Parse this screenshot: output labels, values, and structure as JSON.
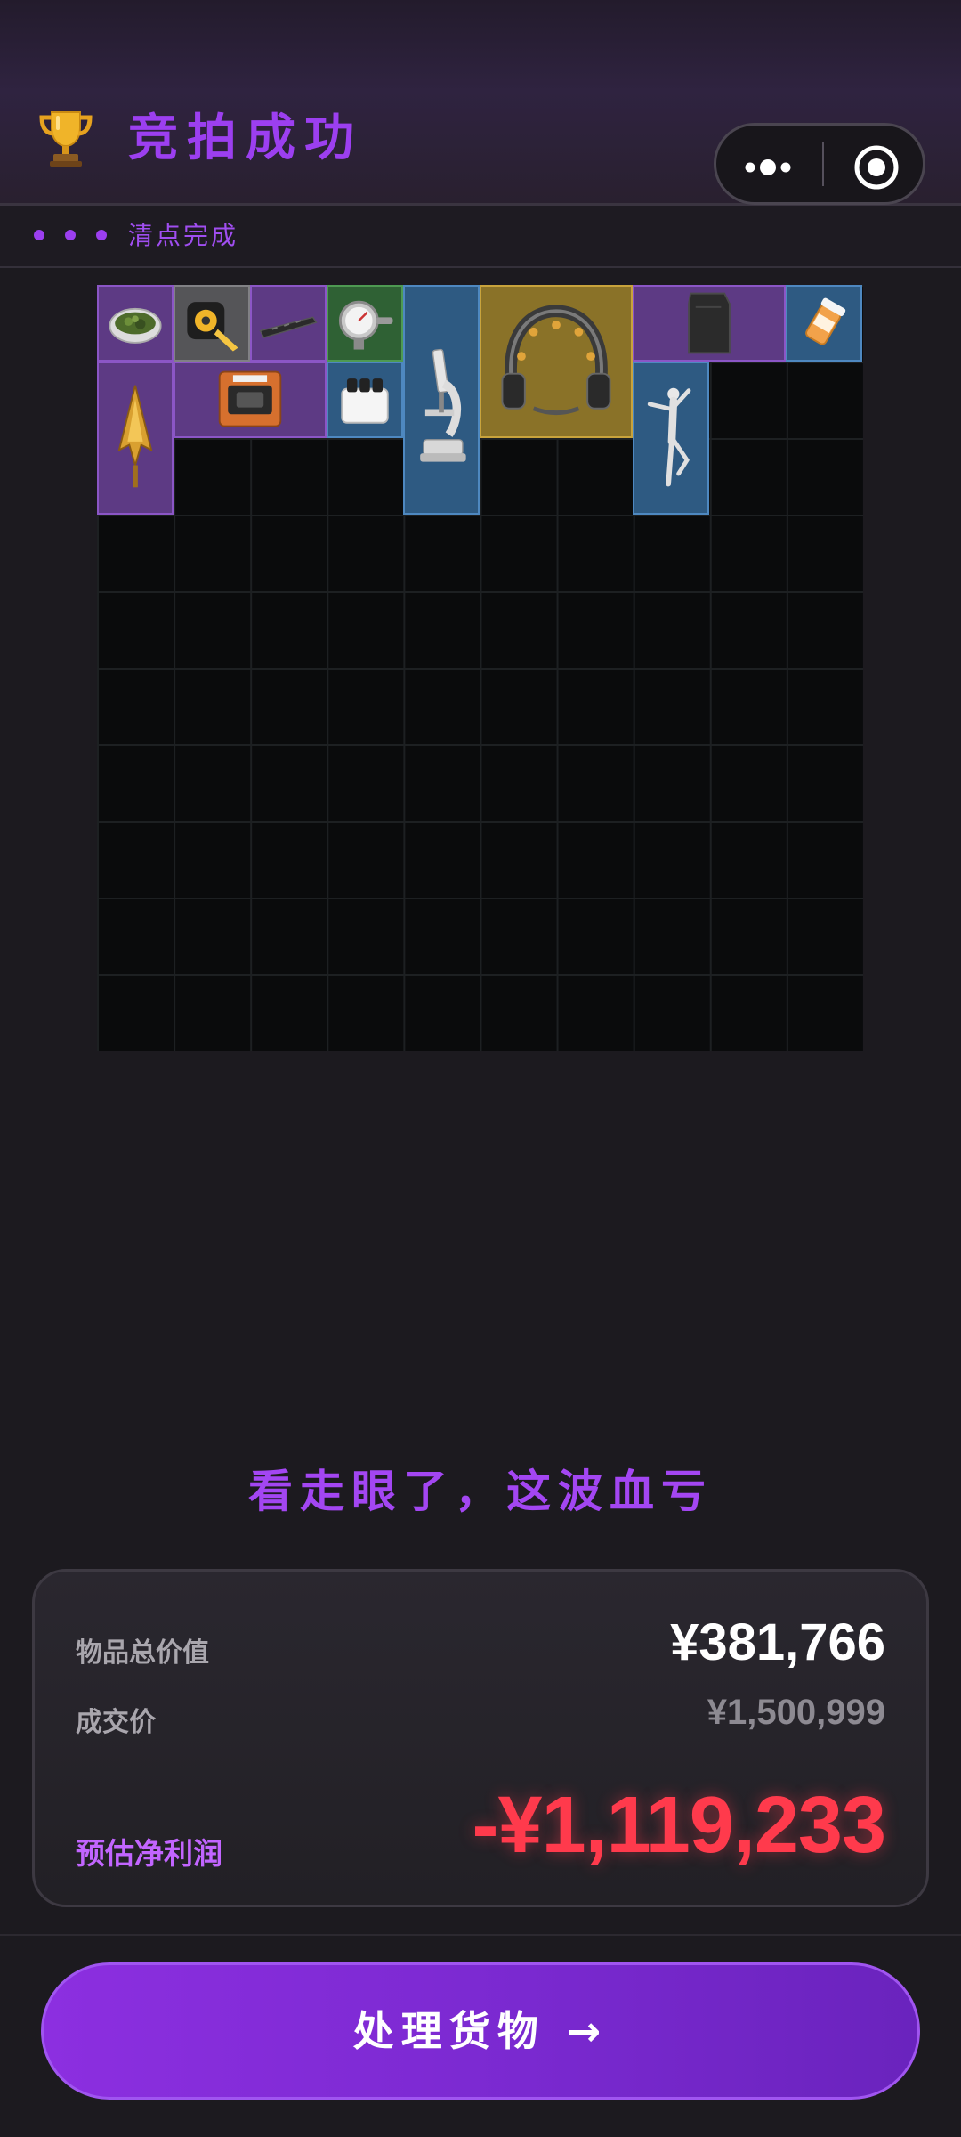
{
  "header": {
    "title": "竞拍成功",
    "trophy_icon": "trophy-icon"
  },
  "status": {
    "text": "清点完成"
  },
  "colors": {
    "accent": "#9c3ff0",
    "loss": "#ff3a4c",
    "button": "#8c2fe0"
  },
  "grid": {
    "columns": 10,
    "rows": 10
  },
  "items": [
    {
      "name": "herbs-dish",
      "rarity": "purple"
    },
    {
      "name": "tape-measure",
      "rarity": "gray"
    },
    {
      "name": "blade-bar",
      "rarity": "purple"
    },
    {
      "name": "gauge-dial",
      "rarity": "green"
    },
    {
      "name": "microscope",
      "rarity": "blue"
    },
    {
      "name": "tech-headset",
      "rarity": "gold"
    },
    {
      "name": "armor-plate",
      "rarity": "purple"
    },
    {
      "name": "pill-bottle",
      "rarity": "blue"
    },
    {
      "name": "golden-arrowhead",
      "rarity": "purple"
    },
    {
      "name": "electronic-device",
      "rarity": "purple"
    },
    {
      "name": "battery-pack",
      "rarity": "blue"
    },
    {
      "name": "dancer-figurine",
      "rarity": "blue"
    }
  ],
  "verdict": "看走眼了，这波血亏",
  "summary": {
    "total_value_label": "物品总价值",
    "total_value": "¥381,766",
    "deal_price_label": "成交价",
    "deal_price": "¥1,500,999",
    "net_profit_label": "预估净利润",
    "net_profit": "-¥1,119,233"
  },
  "action": {
    "label": "处理货物 →"
  }
}
